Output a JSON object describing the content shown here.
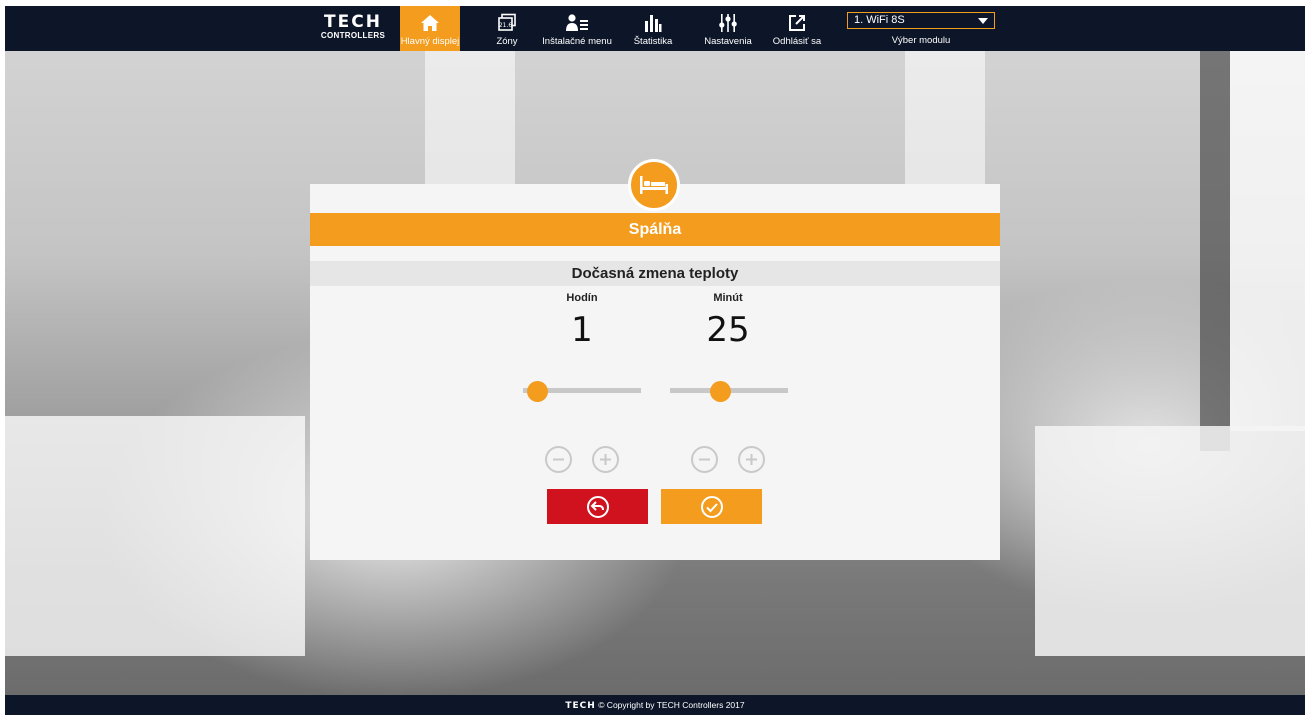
{
  "header": {
    "logo_main": "TECH",
    "logo_sub": "CONTROLLERS",
    "nav": [
      {
        "label": "Hlavný displej",
        "icon": "home-icon",
        "active": true
      },
      {
        "label": "Zóny",
        "icon": "zones-icon",
        "active": false
      },
      {
        "label": "Inštalačné menu",
        "icon": "installer-menu-icon",
        "active": false
      },
      {
        "label": "Štatistika",
        "icon": "statistics-icon",
        "active": false
      },
      {
        "label": "Nastavenia",
        "icon": "settings-sliders-icon",
        "active": false
      },
      {
        "label": "Odhlásiť sa",
        "icon": "logout-icon",
        "active": false
      }
    ],
    "module_select": {
      "value": "1. WiFi 8S",
      "label": "Výber modulu"
    }
  },
  "dialog": {
    "zone_icon": "bed-icon",
    "zone_name": "Spálňa",
    "section_title": "Dočasná zmena teploty",
    "hours": {
      "label": "Hodín",
      "value": "1",
      "slider_fraction": 0.12
    },
    "minutes": {
      "label": "Minút",
      "value": "25",
      "slider_fraction": 0.42
    },
    "buttons": {
      "back": {
        "icon": "back-arrow-icon",
        "color": "#d0121f"
      },
      "confirm": {
        "icon": "checkmark-icon",
        "color": "#f39c1e"
      }
    }
  },
  "footer": {
    "logo": "TECH",
    "text": "© Copyright by TECH Controllers 2017"
  },
  "colors": {
    "accent": "#f39c1e",
    "navbar": "#0d1628",
    "cancel": "#d0121f"
  }
}
